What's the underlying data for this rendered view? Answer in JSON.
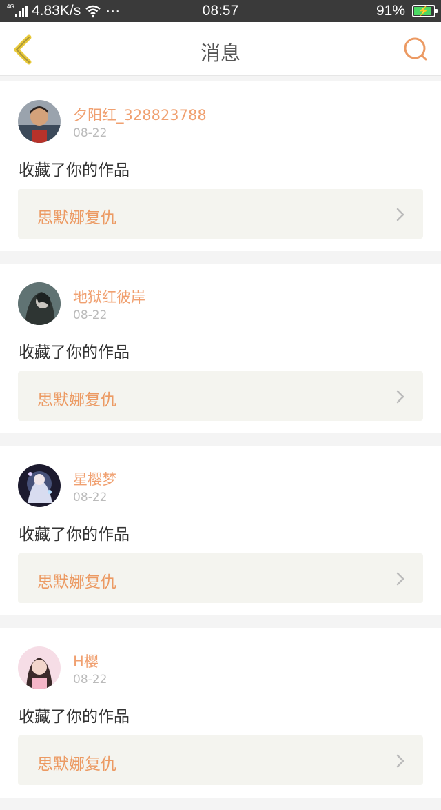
{
  "status_bar": {
    "network_tag": "4G",
    "speed": "4.83K/s",
    "wifi_icon": "wifi-icon",
    "more": "···",
    "time": "08:57",
    "battery_percent": "91%",
    "battery_level": 0.91
  },
  "header": {
    "title": "消息",
    "back_icon": "chevron-left-icon",
    "search_icon": "search-icon"
  },
  "colors": {
    "accent": "#ec9a63",
    "back_arrow": "#e8c93a",
    "username": "#f0a070"
  },
  "messages": [
    {
      "username": "夕阳红_328823788",
      "date": "08-22",
      "action": "收藏了你的作品",
      "work_title": "思默娜复仇"
    },
    {
      "username": "地狱红彼岸",
      "date": "08-22",
      "action": "收藏了你的作品",
      "work_title": "思默娜复仇"
    },
    {
      "username": "星樱梦",
      "date": "08-22",
      "action": "收藏了你的作品",
      "work_title": "思默娜复仇"
    },
    {
      "username": "H樱",
      "date": "08-22",
      "action": "收藏了你的作品",
      "work_title": "思默娜复仇"
    }
  ]
}
